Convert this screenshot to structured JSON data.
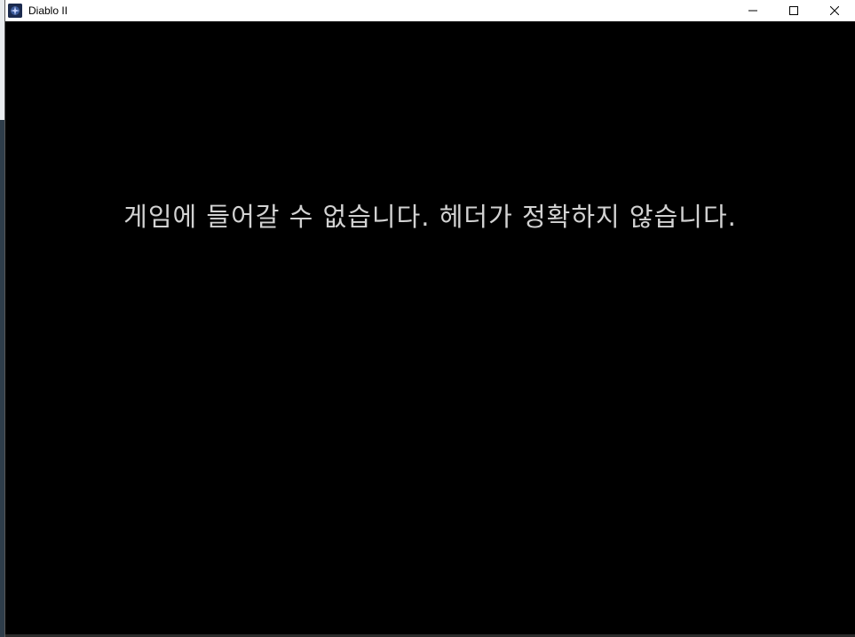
{
  "window": {
    "title": "Diablo II",
    "icon": "diablo-ii-app-icon",
    "controls": {
      "minimize_icon": "minimize-icon",
      "maximize_icon": "maximize-icon",
      "close_icon": "close-icon"
    }
  },
  "game": {
    "message": "게임에 들어갈 수 없습니다. 헤더가 정확하지 않습니다."
  },
  "colors": {
    "titlebar_bg": "#ffffff",
    "client_bg": "#000000",
    "message_text": "#d2d2d2"
  }
}
